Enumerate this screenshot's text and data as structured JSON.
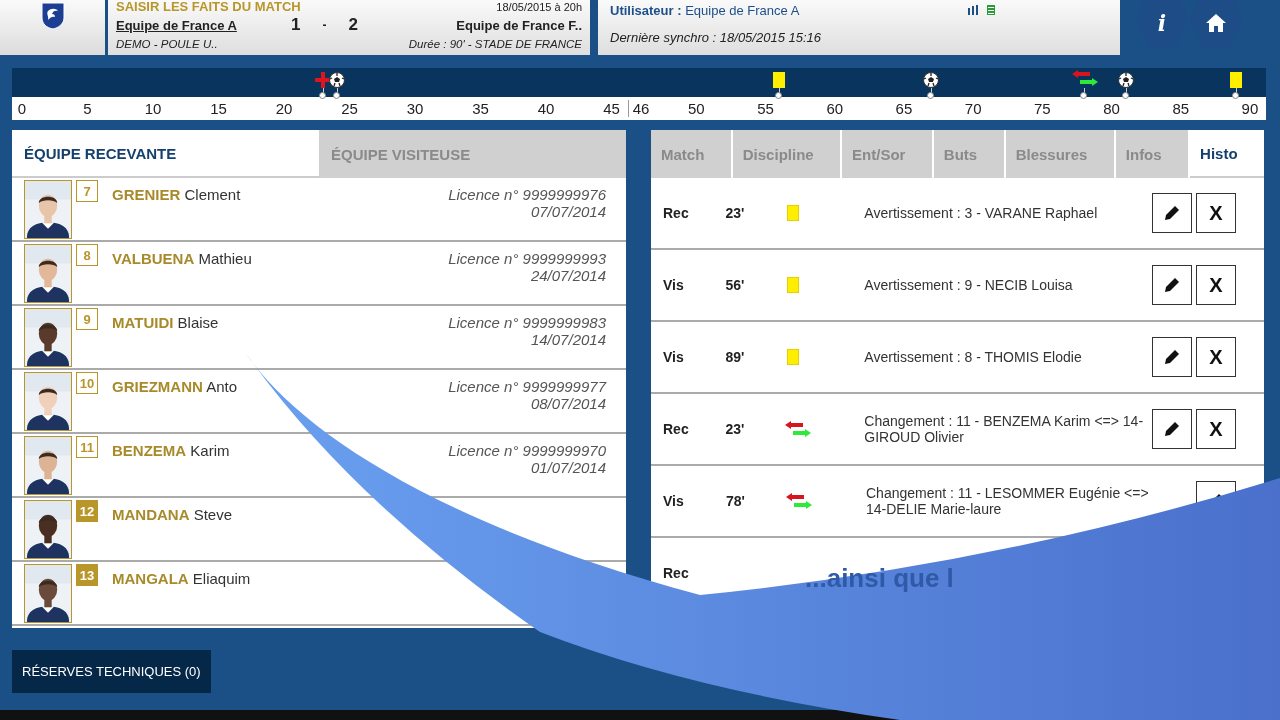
{
  "header": {
    "title": "SAISIR LES FAITS DU MATCH",
    "date": "18/05/2015 à 20h",
    "home_team": "Equipe de France A",
    "score_home": "1",
    "score_separator": "-",
    "score_away": "2",
    "away_team": "Equipe de France F..",
    "competition": "DEMO - POULE U..",
    "details": "Durée : 90' - STADE DE FRANCE",
    "user_label": "Utilisateur :",
    "user": "Equipe de France A",
    "sync": "Dernière synchro : 18/05/2015 15:16",
    "info_button": "i"
  },
  "timeline": {
    "ticks_first_half": [
      "0",
      "5",
      "10",
      "15",
      "20",
      "25",
      "30",
      "35",
      "40",
      "45"
    ],
    "ticks_second_half": [
      "46",
      "50",
      "55",
      "60",
      "65",
      "70",
      "75",
      "80",
      "85",
      "90"
    ],
    "events": [
      {
        "kind": "injury",
        "level": 0.248
      },
      {
        "kind": "goal",
        "level": 0.259
      },
      {
        "kind": "yellow",
        "level": 0.612
      },
      {
        "kind": "goal",
        "level": 0.733
      },
      {
        "kind": "substitution",
        "level": 0.855
      },
      {
        "kind": "goal",
        "level": 0.888
      },
      {
        "kind": "yellow",
        "level": 0.976
      }
    ]
  },
  "teams_panel": {
    "tabs": [
      {
        "label": "ÉQUIPE RECEVANTE",
        "selected": true
      },
      {
        "label": "ÉQUIPE VISITEUSE",
        "selected": false
      }
    ],
    "players": [
      {
        "number": "7",
        "last_name": "GRENIER",
        "first_name": "Clement",
        "licence": "Licence n° 9999999976",
        "date": "07/07/2014",
        "substitute": false
      },
      {
        "number": "8",
        "last_name": "VALBUENA",
        "first_name": "Mathieu",
        "licence": "Licence n° 9999999993",
        "date": "24/07/2014",
        "substitute": false
      },
      {
        "number": "9",
        "last_name": "MATUIDI",
        "first_name": "Blaise",
        "licence": "Licence n° 9999999983",
        "date": "14/07/2014",
        "substitute": false
      },
      {
        "number": "10",
        "last_name": "GRIEZMANN",
        "first_name": "Anto",
        "licence": "Licence n° 9999999977",
        "date": "08/07/2014",
        "substitute": false
      },
      {
        "number": "11",
        "last_name": "BENZEMA",
        "first_name": "Karim",
        "licence": "Licence n° 9999999970",
        "date": "01/07/2014",
        "substitute": false
      },
      {
        "number": "12",
        "last_name": "MANDANA",
        "first_name": "Steve",
        "substitute": true
      },
      {
        "number": "13",
        "last_name": "MANGALA",
        "first_name": "Eliaquim",
        "substitute": true
      }
    ]
  },
  "events_panel": {
    "tabs": [
      {
        "label": "Match",
        "selected": false
      },
      {
        "label": "Discipline",
        "selected": false
      },
      {
        "label": "Ent/Sor",
        "selected": false
      },
      {
        "label": "Buts",
        "selected": false
      },
      {
        "label": "Blessures",
        "selected": false
      },
      {
        "label": "Infos",
        "selected": false
      },
      {
        "label": "Histo",
        "selected": true
      }
    ],
    "rows": [
      {
        "team": "Rec",
        "minute": "23'",
        "kind": "yellow",
        "text": "Avertissement : 3 - VARANE Raphael",
        "delete": "X"
      },
      {
        "team": "Vis",
        "minute": "56'",
        "kind": "yellow",
        "text": "Avertissement : 9 - NECIB Louisa",
        "delete": "X"
      },
      {
        "team": "Vis",
        "minute": "89'",
        "kind": "yellow",
        "text": "Avertissement : 8 - THOMIS Elodie",
        "delete": "X"
      },
      {
        "team": "Rec",
        "minute": "23'",
        "kind": "substitution",
        "text": "Changement : 11 - BENZEMA Karim <=> 14-GIROUD Olivier",
        "delete": "X"
      },
      {
        "team": "Vis",
        "minute": "78'",
        "kind": "substitution",
        "text": "Changement : 11 - LESOMMER Eugénie <=> 14-DELIE Marie-laure"
      },
      {
        "team": "Rec"
      }
    ]
  },
  "reserves_button": "RÉSERVES TECHNIQUES (0)",
  "overlay": {
    "caption": "...ainsi que l"
  }
}
